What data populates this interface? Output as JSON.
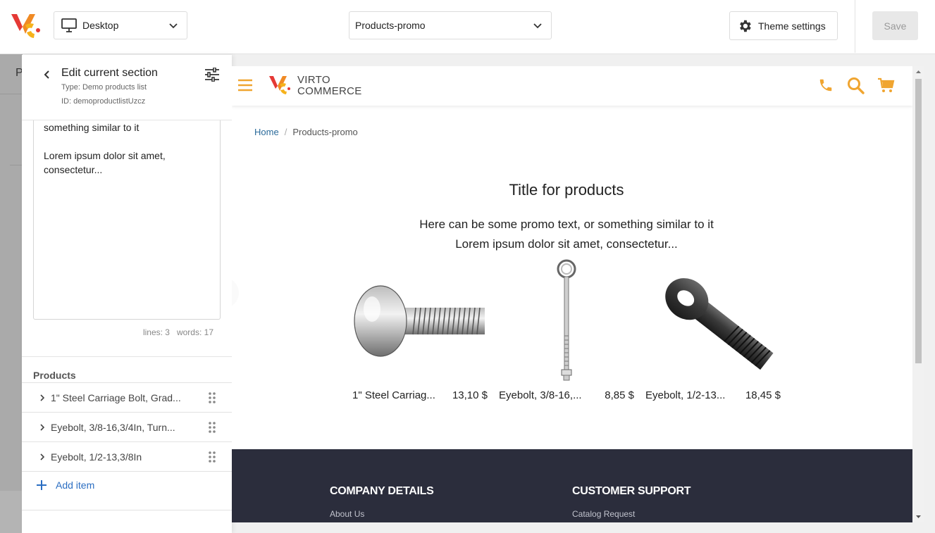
{
  "topbar": {
    "device_label": "Desktop",
    "page_label": "Products-promo",
    "theme_settings_label": "Theme settings",
    "save_label": "Save"
  },
  "background": {
    "peek_letter": "P"
  },
  "panel": {
    "title": "Edit current section",
    "type_line": "Type: Demo products list",
    "id_line": "ID: demoproductlistUzcz",
    "textarea_line1": "something similar to it",
    "textarea_line2": "Lorem ipsum dolor sit amet, consectetur...",
    "counter": "lines: 3   words: 17",
    "products_label": "Products",
    "products": [
      {
        "name": "1\" Steel Carriage Bolt, Grad..."
      },
      {
        "name": "Eyebolt, 3/8-16,3/4In, Turn..."
      },
      {
        "name": "Eyebolt, 1/2-13,3/8In"
      }
    ],
    "add_item_label": "Add item"
  },
  "preview": {
    "logo_line1": "VIRTO",
    "logo_line2": "COMMERCE",
    "breadcrumb_home": "Home",
    "breadcrumb_sep": "/",
    "breadcrumb_current": "Products-promo",
    "title": "Title for products",
    "promo_line1": "Here can be some promo text, or something similar to it",
    "promo_line2": "Lorem ipsum dolor sit amet, consectetur...",
    "cards": [
      {
        "name": "1\" Steel Carriag...",
        "price": "13,10 $"
      },
      {
        "name": "Eyebolt, 3/8-16,...",
        "price": "8,85 $"
      },
      {
        "name": "Eyebolt, 1/2-13...",
        "price": "18,45 $"
      }
    ],
    "footer": {
      "col1_heading": "COMPANY DETAILS",
      "col1_link": "About Us",
      "col2_heading": "CUSTOMER SUPPORT",
      "col2_link": "Catalog Request"
    }
  },
  "colors": {
    "accent_orange": "#f0a530",
    "link_blue": "#2b6ec2",
    "footer_bg": "#2b2d3c",
    "logo_red": "#e53935",
    "logo_yellow": "#f6b21b"
  },
  "icons": [
    "vc-logo-icon",
    "monitor-icon",
    "chevron-down-icon",
    "gear-icon",
    "chevron-left-icon",
    "tune-icon",
    "chevron-right-icon",
    "drag-handle-icon",
    "plus-icon",
    "hamburger-icon",
    "phone-icon",
    "search-icon",
    "cart-icon"
  ]
}
